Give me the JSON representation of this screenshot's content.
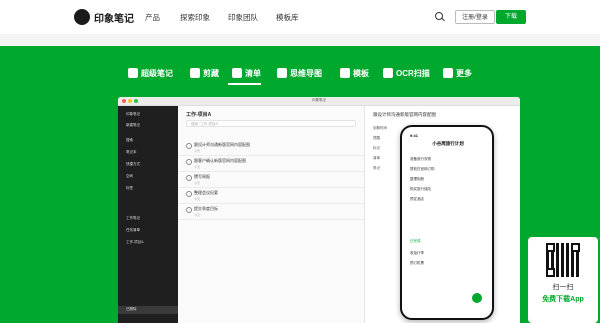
{
  "brand": {
    "name": "印象笔记",
    "accent": "#00a82d"
  },
  "nav": {
    "items": [
      "产品",
      "探索印象",
      "印象团队",
      "模板库"
    ],
    "login": "注册/登录",
    "download": "下载"
  },
  "features": [
    "超级笔记",
    "剪藏",
    "清单",
    "思维导图",
    "模板",
    "OCR扫描",
    "更多"
  ],
  "active_feature": "清单",
  "app": {
    "title": "印象笔记",
    "sidebar": [
      "印象笔记",
      "新建笔记",
      "搜索",
      "笔记本",
      "快捷方式",
      "空间",
      "标签",
      "工作笔记",
      "任务清单",
      "工作-项目A",
      "已删除"
    ],
    "list_title": "工作-项目A",
    "search_placeholder": "搜索 \"工作-项目A\"",
    "rows": [
      {
        "title": "跟设计师沟通新版官网内容配图",
        "sub": "今天"
      },
      {
        "title": "跟客户确认新版官网内容配图",
        "sub": "今天"
      },
      {
        "title": "撰写周报",
        "sub": "今天"
      },
      {
        "title": "整理会议纪要",
        "sub": "今天"
      },
      {
        "title": "提交季度目标",
        "sub": "今天"
      }
    ],
    "detail_title": "跟设计师沟通新版官网内容配图",
    "detail_rows": [
      "到期时间",
      "提醒",
      "标记",
      "清单",
      "笔记"
    ]
  },
  "phone": {
    "time": "9:41",
    "heading": "小谷周旅行计划",
    "items": [
      "准备旅行衣物",
      "提前在官网订购",
      "整理相册",
      "购买旅行保险",
      "预定酒店"
    ],
    "section": "已完成",
    "done_items": [
      "收拾行李",
      "预订机票"
    ]
  },
  "qr": {
    "line1": "扫一扫",
    "line2": "免费下载App"
  }
}
